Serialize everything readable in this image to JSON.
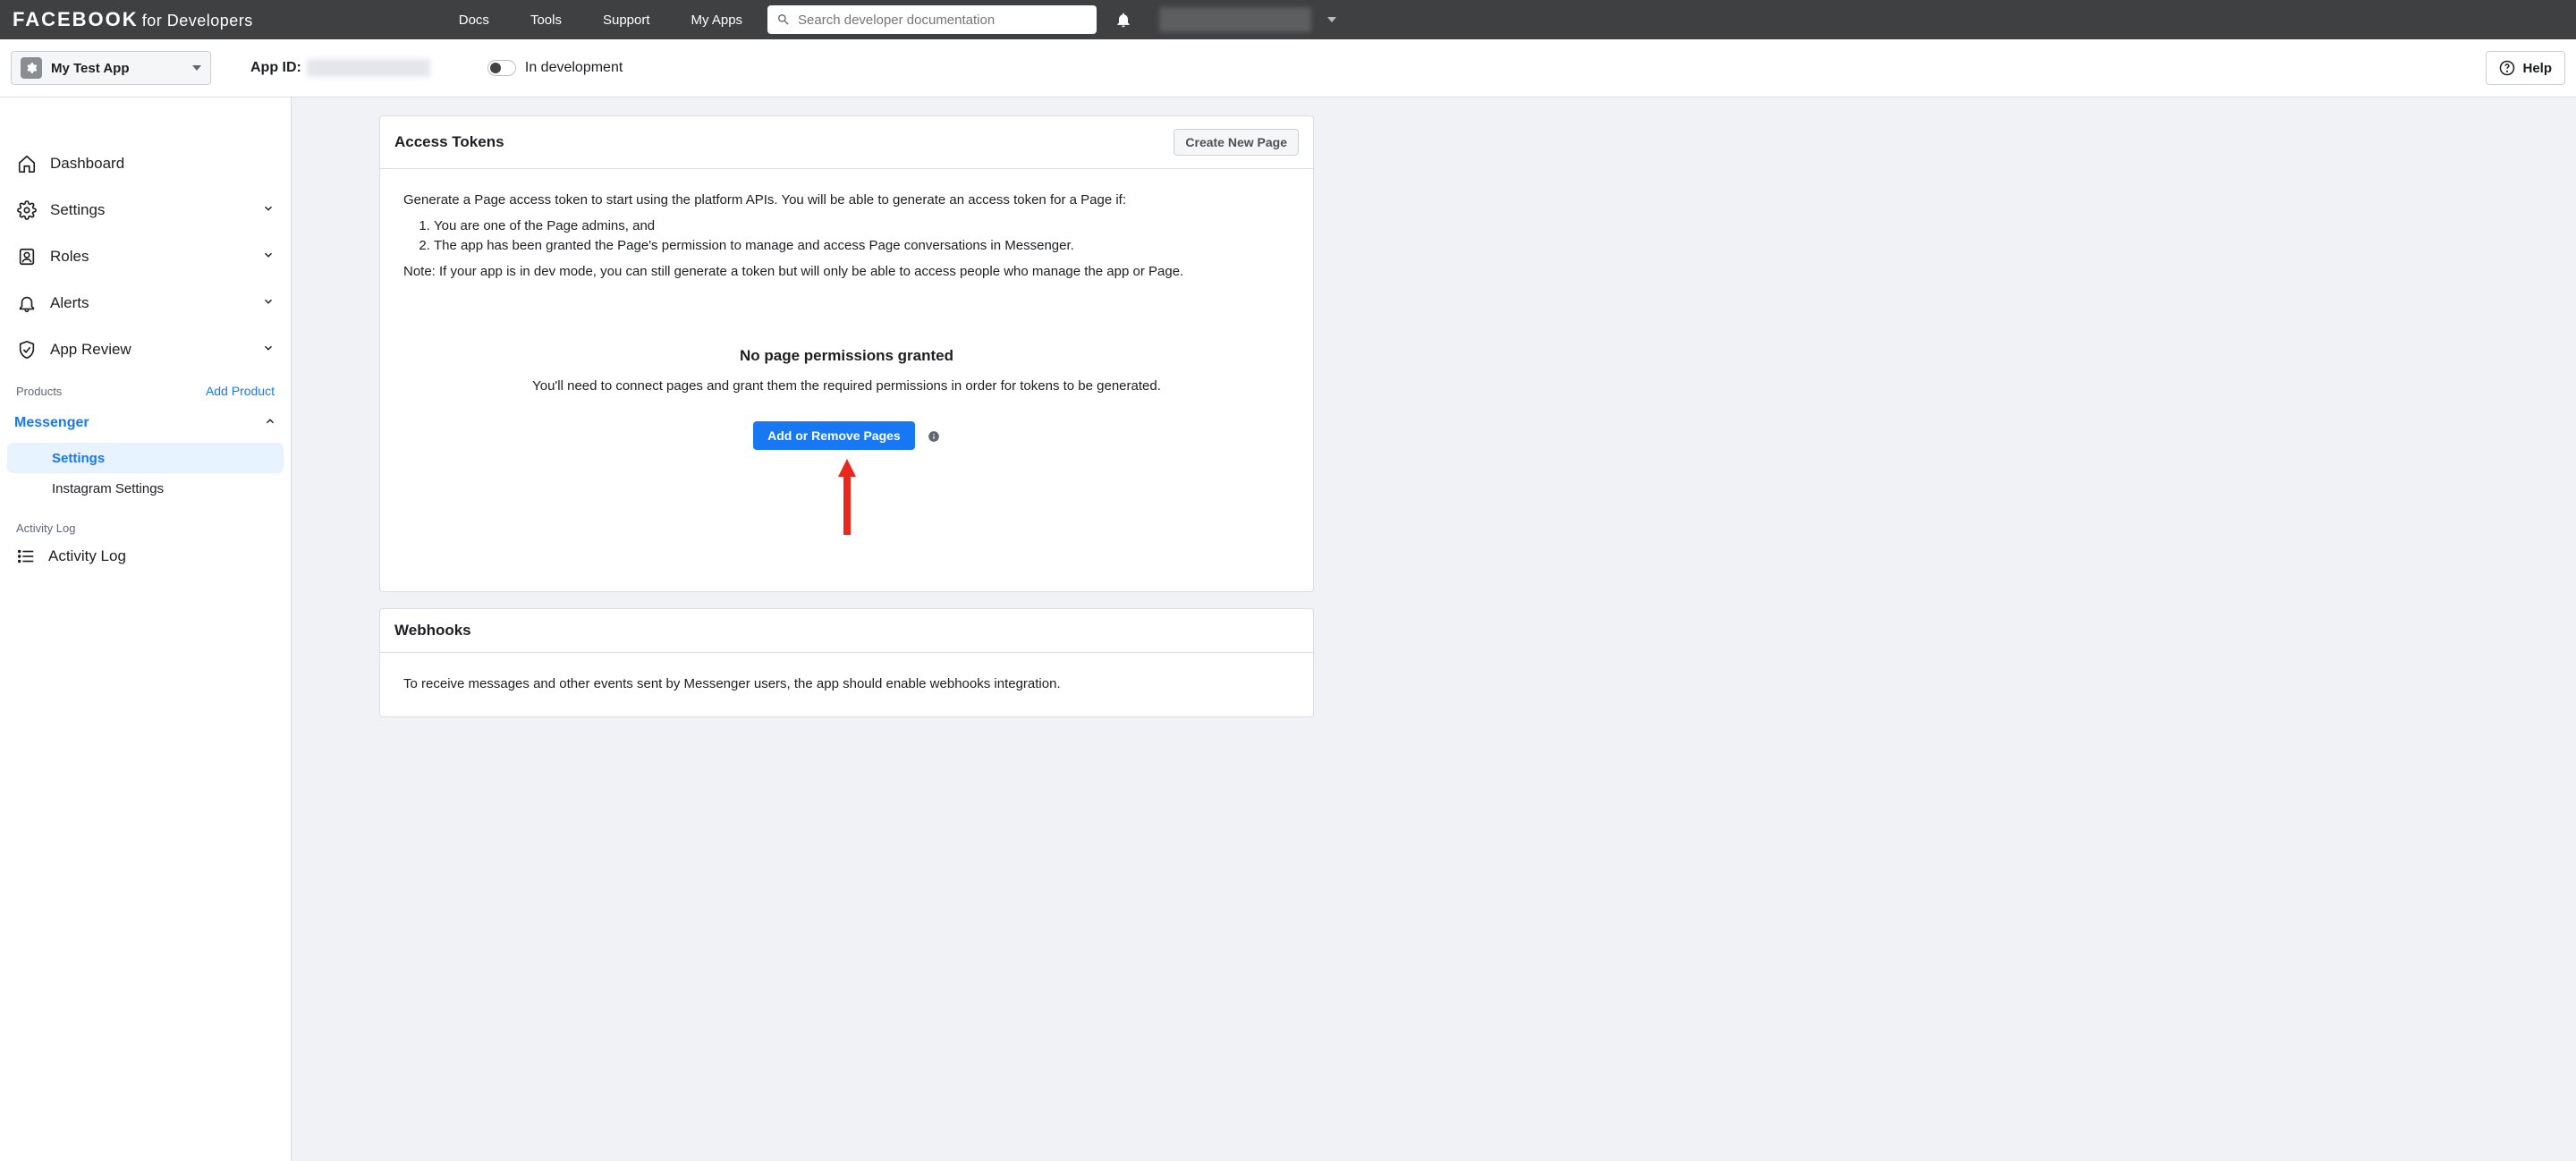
{
  "topnav": {
    "brand_main": "FACEBOOK",
    "brand_sub": "for Developers",
    "links": [
      "Docs",
      "Tools",
      "Support",
      "My Apps"
    ],
    "search_placeholder": "Search developer documentation"
  },
  "subheader": {
    "app_name": "My Test App",
    "app_id_label": "App ID:",
    "status_label": "In development",
    "help_label": "Help"
  },
  "sidebar": {
    "items": [
      {
        "label": "Dashboard",
        "expandable": false
      },
      {
        "label": "Settings",
        "expandable": true
      },
      {
        "label": "Roles",
        "expandable": true
      },
      {
        "label": "Alerts",
        "expandable": true
      },
      {
        "label": "App Review",
        "expandable": true
      }
    ],
    "products_label": "Products",
    "add_product": "Add Product",
    "product_name": "Messenger",
    "subitems": [
      "Settings",
      "Instagram Settings"
    ],
    "activity_group": "Activity Log",
    "activity_item": "Activity Log"
  },
  "tokens_card": {
    "title": "Access Tokens",
    "create_btn": "Create New Page",
    "intro": "Generate a Page access token to start using the platform APIs. You will be able to generate an access token for a Page if:",
    "cond1": "You are one of the Page admins, and",
    "cond2": "The app has been granted the Page's permission to manage and access Page conversations in Messenger.",
    "note": "Note: If your app is in dev mode, you can still generate a token but will only be able to access people who manage the app or Page.",
    "empty_title": "No page permissions granted",
    "empty_desc": "You'll need to connect pages and grant them the required permissions in order for tokens to be generated.",
    "add_btn": "Add or Remove Pages"
  },
  "webhooks_card": {
    "title": "Webhooks",
    "desc": "To receive messages and other events sent by Messenger users, the app should enable webhooks integration."
  }
}
